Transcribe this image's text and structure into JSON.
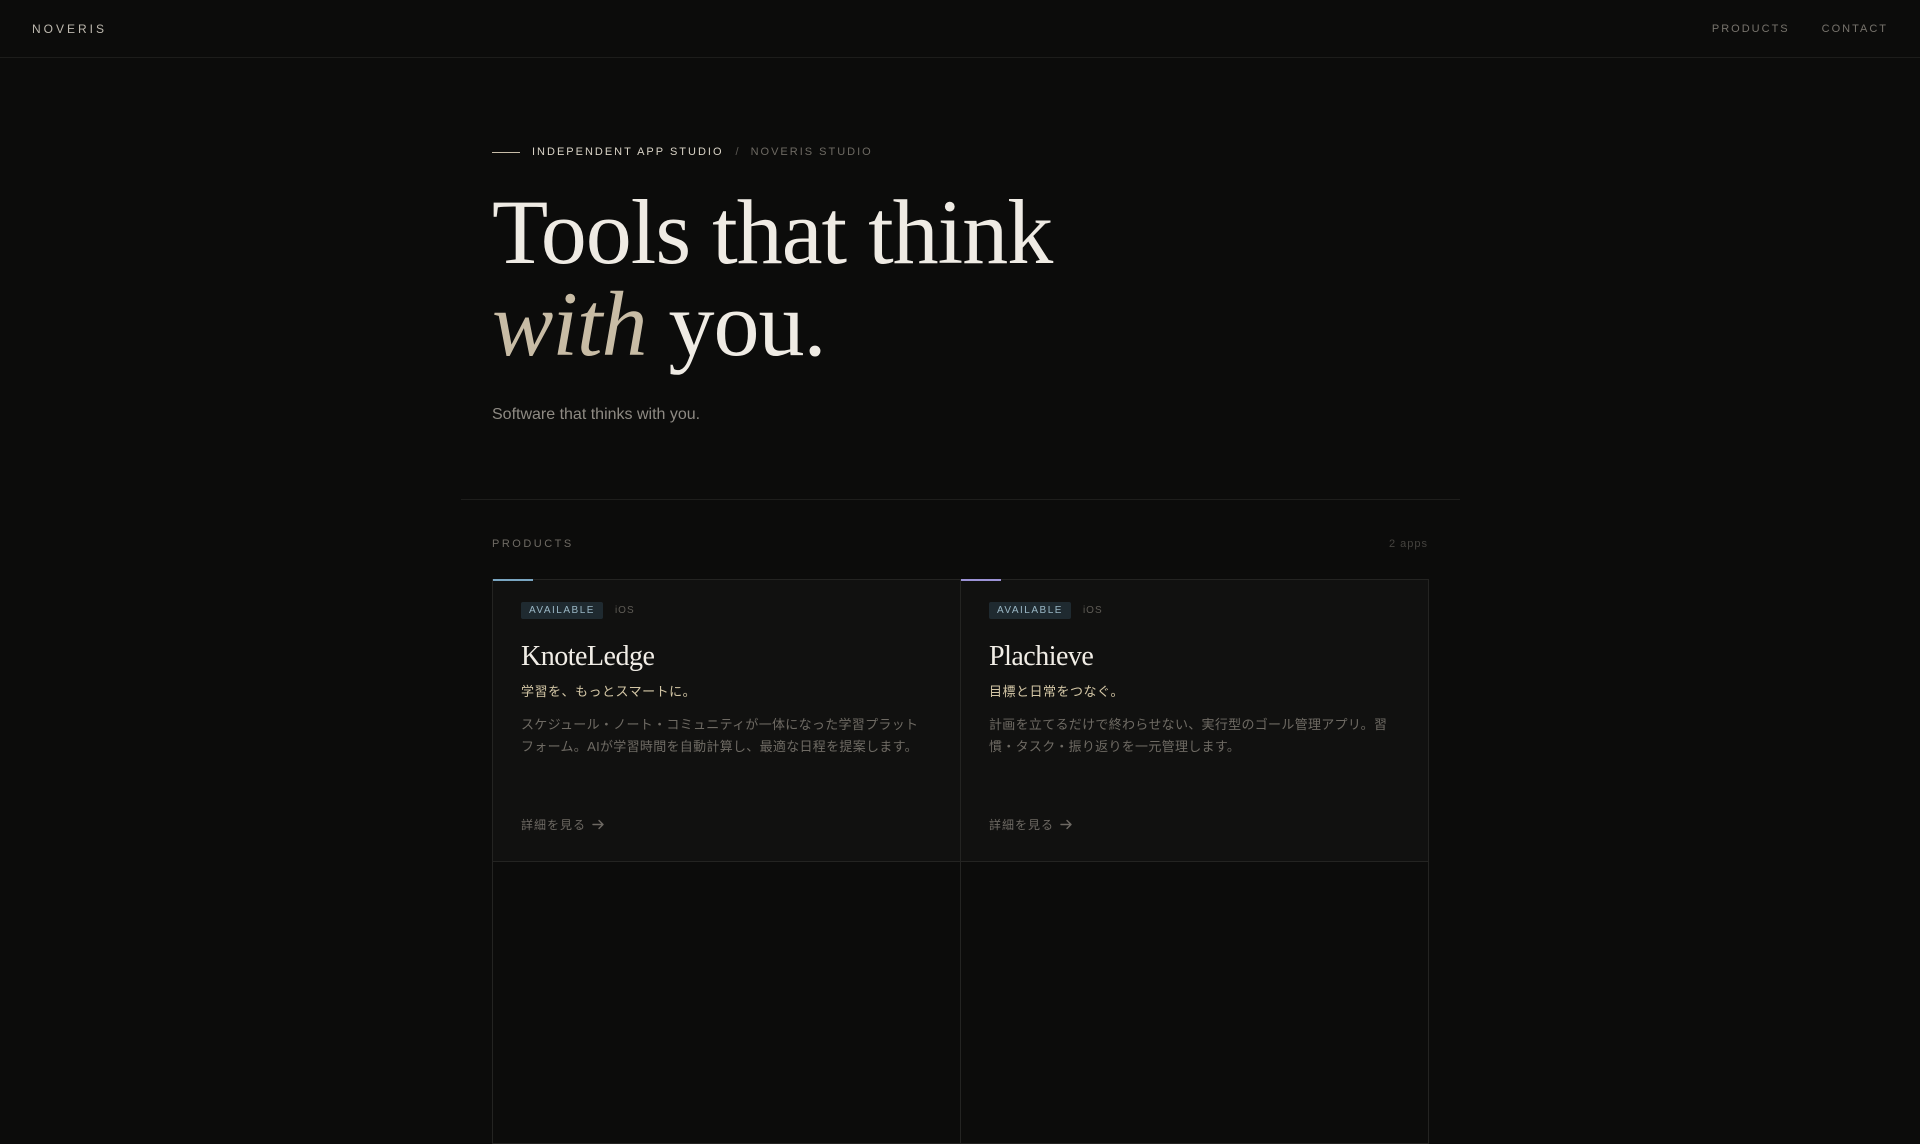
{
  "header": {
    "brand": "NOVERIS",
    "nav": [
      {
        "label": "PRODUCTS"
      },
      {
        "label": "CONTACT"
      }
    ]
  },
  "hero": {
    "eyebrow_primary": "INDEPENDENT APP STUDIO",
    "eyebrow_separator": "/",
    "eyebrow_secondary": "NOVERIS STUDIO",
    "headline_line1": "Tools that think",
    "headline_accent": "with",
    "headline_rest": " you.",
    "subtitle": "Software that thinks with you."
  },
  "products": {
    "section_label": "PRODUCTS",
    "count_label": "2 apps",
    "items": [
      {
        "status": "AVAILABLE",
        "platform": "iOS",
        "name": "KnoteLedge",
        "tagline": "学習を、もっとスマートに。",
        "description": "スケジュール・ノート・コミュニティが一体になった学習プラットフォーム。AIが学習時間を自動計算し、最適な日程を提案します。",
        "link_label": "詳細を見る",
        "accent_color": "#7aa6c2"
      },
      {
        "status": "AVAILABLE",
        "platform": "iOS",
        "name": "Plachieve",
        "tagline": "目標と日常をつなぐ。",
        "description": "計画を立てるだけで終わらせない、実行型のゴール管理アプリ。習慣・タスク・振り返りを一元管理します。",
        "link_label": "詳細を見る",
        "accent_color": "#9c93d6"
      }
    ]
  }
}
